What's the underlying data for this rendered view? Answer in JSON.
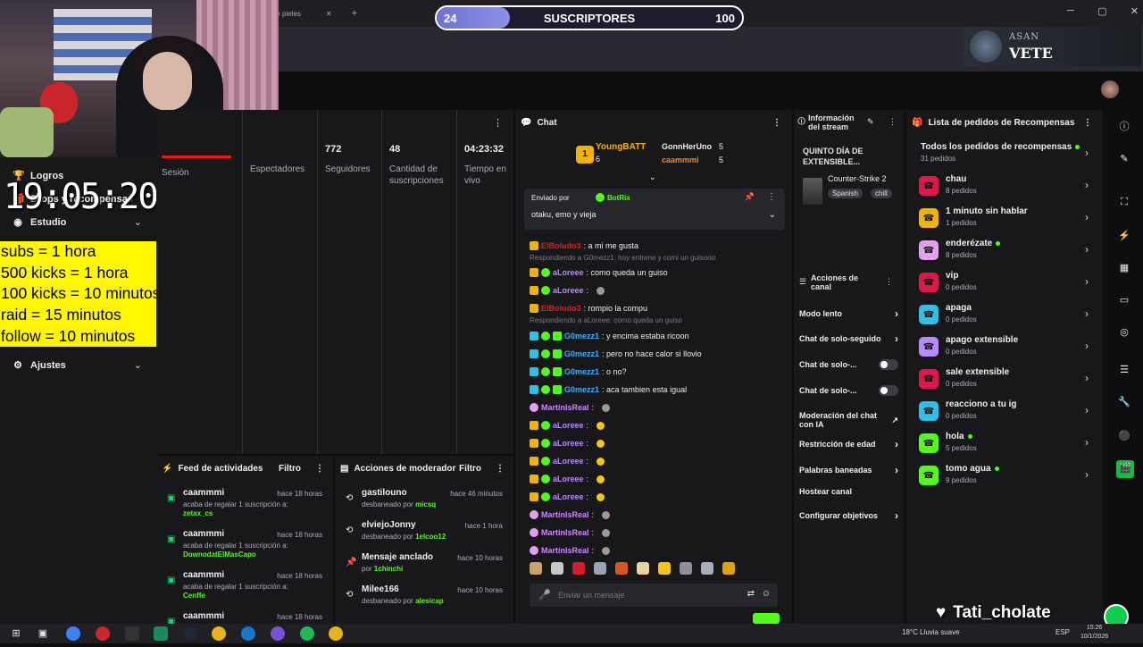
{
  "browser": {
    "tab_fragment": "r de pieles",
    "tab_close": "✕",
    "tab_new": "+",
    "win_min": "─",
    "win_max": "▢",
    "win_close": "✕"
  },
  "sub_goal": {
    "current": "24",
    "title": "SUSCRIPTORES",
    "goal": "100",
    "progress_fraction": 0.24
  },
  "banner": {
    "small": "ASAN",
    "large": "VETE"
  },
  "sidebar": {
    "logros": "Logros",
    "drops": "Drops y recompensas",
    "estudio": "Estudio",
    "ajustes": "Ajustes"
  },
  "clock": "19:05:20",
  "yellow_box": [
    "subs = 1 hora",
    "500 kicks = 1 hora",
    "100 kicks = 10 minutos",
    "raid = 15 minutos",
    "follow = 10 minutos"
  ],
  "stats": {
    "session_label": "Sesión",
    "viewers_label": "Espectadores",
    "followers_value": "772",
    "followers_label": "Seguidores",
    "subs_value": "48",
    "subs_label": "Cantidad de suscripciones",
    "live_value": "04:23:32",
    "live_label": "Tiempo en vivo"
  },
  "activity_feed": {
    "title": "Feed de actividades",
    "filter": "Filtro",
    "items": [
      {
        "name": "caammmi",
        "time": "hace 18 horas",
        "line": "acaba de regalar 1 suscripción a:",
        "target": "zetax_cs"
      },
      {
        "name": "caammmi",
        "time": "hace 18 horas",
        "line": "acaba de regalar 1 suscripción a:",
        "target": "DownodatElMasCapo"
      },
      {
        "name": "caammmi",
        "time": "hace 18 horas",
        "line": "acaba de regalar 1 suscripción a:",
        "target": "Cenffe"
      },
      {
        "name": "caammmi",
        "time": "hace 18 horas",
        "line": "",
        "target": ""
      }
    ]
  },
  "mod_actions": {
    "title": "Acciones de moderador",
    "filter": "Filtro",
    "items": [
      {
        "name": "gastilouno",
        "time": "hace 46 minutos",
        "line": "desbaneado por",
        "by": "micsq",
        "icon": "⟲"
      },
      {
        "name": "elviejoJonny",
        "time": "hace 1 hora",
        "line": "desbaneado por",
        "by": "1elcoo12",
        "icon": "⟲"
      },
      {
        "name": "Mensaje anclado",
        "time": "hace 10 horas",
        "line": "por",
        "by": "1chinchi",
        "icon": "📌"
      },
      {
        "name": "Milee166",
        "time": "hace 10 horas",
        "line": "desbaneado por",
        "by": "alesicap",
        "icon": "⟲"
      }
    ]
  },
  "chat": {
    "title": "Chat",
    "leader1": "YoungBATT",
    "leader1_count": "6",
    "leader1_rank": "1",
    "leader2": "GonnHerUno",
    "leader2_count": "5",
    "leader3": "caammmi",
    "leader3_count": "5",
    "pinned_by_label": "Enviado por",
    "pinned_by": "BotRix",
    "pinned_msg": "otaku, emo y vieja",
    "input_placeholder": "Enviar un mensaje",
    "reply1": "Respondiendo a G0mezz1: hoy entrene y comi un guisooo",
    "reply2": "Respondiendo a aLoreee: como queda un guiso",
    "messages": [
      {
        "user": "ElBoludo3",
        "cls": "u-red",
        "text": ": a mi me gusta",
        "badges": [
          "crown"
        ]
      },
      {
        "user": "aLoreee",
        "cls": "u-purple",
        "text": ": como queda un guiso",
        "badges": [
          "crown",
          "star"
        ]
      },
      {
        "user": "aLoreee",
        "cls": "u-purple",
        "text": ":",
        "badges": [
          "crown",
          "star"
        ],
        "emote": "w"
      },
      {
        "user": "ElBoludo3",
        "cls": "u-red",
        "text": ": rompio la compu",
        "badges": [
          "crown"
        ]
      },
      {
        "user": "G0mezz1",
        "cls": "u-blue",
        "text": ": y encima estaba ricoon",
        "badges": [
          "mod",
          "star",
          "green"
        ]
      },
      {
        "user": "G0mezz1",
        "cls": "u-blue",
        "text": ": pero no hace calor si llovio",
        "badges": [
          "mod",
          "star",
          "green"
        ]
      },
      {
        "user": "G0mezz1",
        "cls": "u-blue",
        "text": ": o no?",
        "badges": [
          "mod",
          "star",
          "green"
        ]
      },
      {
        "user": "G0mezz1",
        "cls": "u-blue",
        "text": ": aca tambien esta igual",
        "badges": [
          "mod",
          "star",
          "green"
        ]
      },
      {
        "user": "MartinIsReal",
        "cls": "u-pink",
        "text": ":",
        "badges": [
          "vip"
        ],
        "emote": "w"
      },
      {
        "user": "aLoreee",
        "cls": "u-purple",
        "text": ":",
        "badges": [
          "crown",
          "star"
        ],
        "emote": "y"
      },
      {
        "user": "aLoreee",
        "cls": "u-purple",
        "text": ":",
        "badges": [
          "crown",
          "star"
        ],
        "emote": "y"
      },
      {
        "user": "aLoreee",
        "cls": "u-purple",
        "text": ":",
        "badges": [
          "crown",
          "star"
        ],
        "emote": "y"
      },
      {
        "user": "aLoreee",
        "cls": "u-purple",
        "text": ":",
        "badges": [
          "crown",
          "star"
        ],
        "emote": "y"
      },
      {
        "user": "aLoreee",
        "cls": "u-purple",
        "text": ":",
        "badges": [
          "crown",
          "star"
        ],
        "emote": "y"
      },
      {
        "user": "MartinIsReal",
        "cls": "u-pink",
        "text": ":",
        "badges": [
          "vip"
        ],
        "emote": "w"
      },
      {
        "user": "MartinIsReal",
        "cls": "u-pink",
        "text": ":",
        "badges": [
          "vip"
        ],
        "emote": "w"
      },
      {
        "user": "MartinIsReal",
        "cls": "u-pink",
        "text": ":",
        "badges": [
          "vip"
        ],
        "emote": "w"
      }
    ]
  },
  "stream_info": {
    "title": "Información del stream",
    "stream_title": "QUINTO DÍA DE EXTENSIBLE...",
    "game": "Counter-Strike 2",
    "tag1": "Spanish",
    "tag2": "chill"
  },
  "channel_actions": {
    "title": "Acciones de canal",
    "items": [
      "Modo lento",
      "Chat de solo-seguidores",
      "Chat de solo-...",
      "Chat de solo-...",
      "Moderación del chat con IA",
      "Restricción de edad",
      "Palabras baneadas",
      "Hostear canal",
      "Configurar objetivos"
    ]
  },
  "rewards": {
    "title": "Lista de pedidos de Recompensas",
    "all_label": "Todos los pedidos de recompensas",
    "all_count": "31 pedidos",
    "items": [
      {
        "name": "chau",
        "count": "8 pedidos",
        "color": "#e0184a",
        "dot": false
      },
      {
        "name": "1 minuto sin hablar",
        "count": "1 pedidos",
        "color": "#f0b400",
        "dot": false
      },
      {
        "name": "enderézate",
        "count": "8 pedidos",
        "color": "#e59ff2",
        "dot": true
      },
      {
        "name": "vip",
        "count": "0 pedidos",
        "color": "#e0184a",
        "dot": false
      },
      {
        "name": "apaga",
        "count": "0 pedidos",
        "color": "#2fc0e8",
        "dot": false
      },
      {
        "name": "apago extensible",
        "count": "0 pedidos",
        "color": "#b78bff",
        "dot": false
      },
      {
        "name": "sale extensible",
        "count": "0 pedidos",
        "color": "#e0184a",
        "dot": false
      },
      {
        "name": "reacciono a tu ig",
        "count": "0 pedidos",
        "color": "#2fc0e8",
        "dot": false
      },
      {
        "name": "hola",
        "count": "5 pedidos",
        "color": "#53fc18",
        "dot": true
      },
      {
        "name": "tomo agua",
        "count": "9 pedidos",
        "color": "#53fc18",
        "dot": true
      }
    ]
  },
  "overlay_name": "Tati_cholate",
  "taskbar": {
    "weather": "18°C  Lluvia suave",
    "lang": "ESP",
    "time": "15:26",
    "date": "10/1/2026"
  }
}
